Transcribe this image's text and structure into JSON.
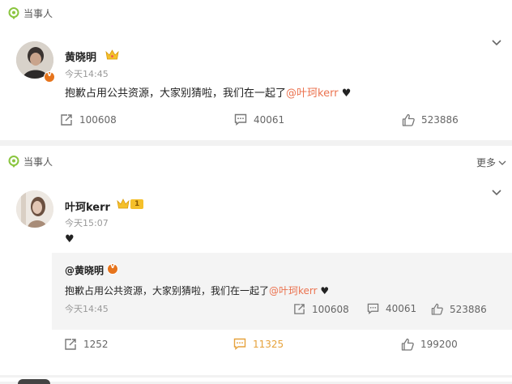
{
  "post1": {
    "label": "当事人",
    "author": "黄晓明",
    "time": "今天14:45",
    "text_prefix": "抱歉占用公共资源，大家别猜啦，我们在一起了",
    "mention": "@叶珂kerr",
    "heart": "♥",
    "repost_count": "100608",
    "comment_count": "40061",
    "like_count": "523886"
  },
  "post2": {
    "label": "当事人",
    "more_label": "更多",
    "author": "叶珂kerr",
    "level_badge": "1",
    "time": "今天15:07",
    "text": "♥",
    "quoted": {
      "author": "@黄晓明",
      "text_prefix": "抱歉占用公共资源，大家别猜啦，我们在一起了",
      "mention": "@叶珂kerr",
      "heart": "♥",
      "time": "今天14:45",
      "repost_count": "100608",
      "comment_count": "40061",
      "like_count": "523886"
    },
    "repost_count": "1252",
    "comment_count": "11325",
    "like_count": "199200"
  },
  "colors": {
    "mention": "#eb7350",
    "pin_green": "#8ac53f",
    "verified_orange": "#e6741c",
    "comment_highlight": "#e6a23c"
  }
}
